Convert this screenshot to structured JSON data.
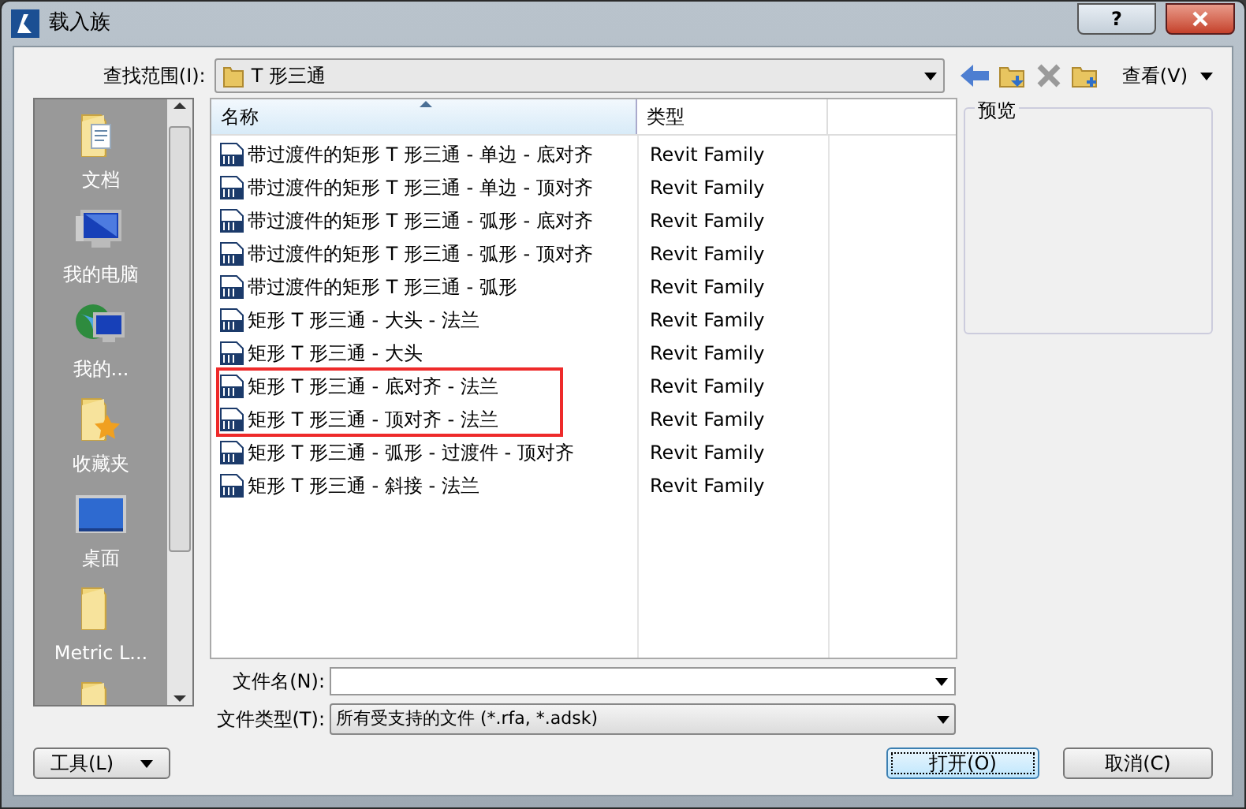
{
  "window": {
    "title": "载入族",
    "help": "?"
  },
  "look_in": {
    "label": "查找范围(I):",
    "value": "T 形三通"
  },
  "toolbar": {
    "view_label": "查看(V)"
  },
  "sidebar": {
    "items": [
      {
        "kind": "documents",
        "label": "文档"
      },
      {
        "kind": "computer",
        "label": "我的电脑"
      },
      {
        "kind": "network",
        "label": "我的..."
      },
      {
        "kind": "favorites",
        "label": "收藏夹"
      },
      {
        "kind": "desktop",
        "label": "桌面"
      },
      {
        "kind": "folder",
        "label": "Metric L..."
      },
      {
        "kind": "folder"
      }
    ]
  },
  "table": {
    "columns": [
      "名称",
      "类型"
    ],
    "rows": [
      {
        "name": "带过渡件的矩形 T 形三通 - 单边 - 底对齐",
        "type": "Revit Family",
        "highlighted": false
      },
      {
        "name": "带过渡件的矩形 T 形三通 - 单边 - 顶对齐",
        "type": "Revit Family",
        "highlighted": false
      },
      {
        "name": "带过渡件的矩形 T 形三通 - 弧形 - 底对齐",
        "type": "Revit Family",
        "highlighted": false
      },
      {
        "name": "带过渡件的矩形 T 形三通 - 弧形 - 顶对齐",
        "type": "Revit Family",
        "highlighted": false
      },
      {
        "name": "带过渡件的矩形 T 形三通 - 弧形",
        "type": "Revit Family",
        "highlighted": false
      },
      {
        "name": "矩形 T 形三通 - 大头 - 法兰",
        "type": "Revit Family",
        "highlighted": false
      },
      {
        "name": "矩形 T 形三通 - 大头",
        "type": "Revit Family",
        "highlighted": false
      },
      {
        "name": "矩形 T 形三通 - 底对齐 - 法兰",
        "type": "Revit Family",
        "highlighted": true
      },
      {
        "name": "矩形 T 形三通 - 顶对齐 - 法兰",
        "type": "Revit Family",
        "highlighted": true
      },
      {
        "name": "矩形 T 形三通 - 弧形 - 过渡件 - 顶对齐",
        "type": "Revit Family",
        "highlighted": false
      },
      {
        "name": "矩形 T 形三通 - 斜接 - 法兰",
        "type": "Revit Family",
        "highlighted": false
      }
    ]
  },
  "preview": {
    "label": "预览"
  },
  "file_name": {
    "label": "文件名(N):"
  },
  "file_type": {
    "label": "文件类型(T):",
    "value": "所有受支持的文件 (*.rfa, *.adsk)"
  },
  "buttons": {
    "tools": "工具(L)",
    "open": "打开(O)",
    "cancel": "取消(C)"
  }
}
